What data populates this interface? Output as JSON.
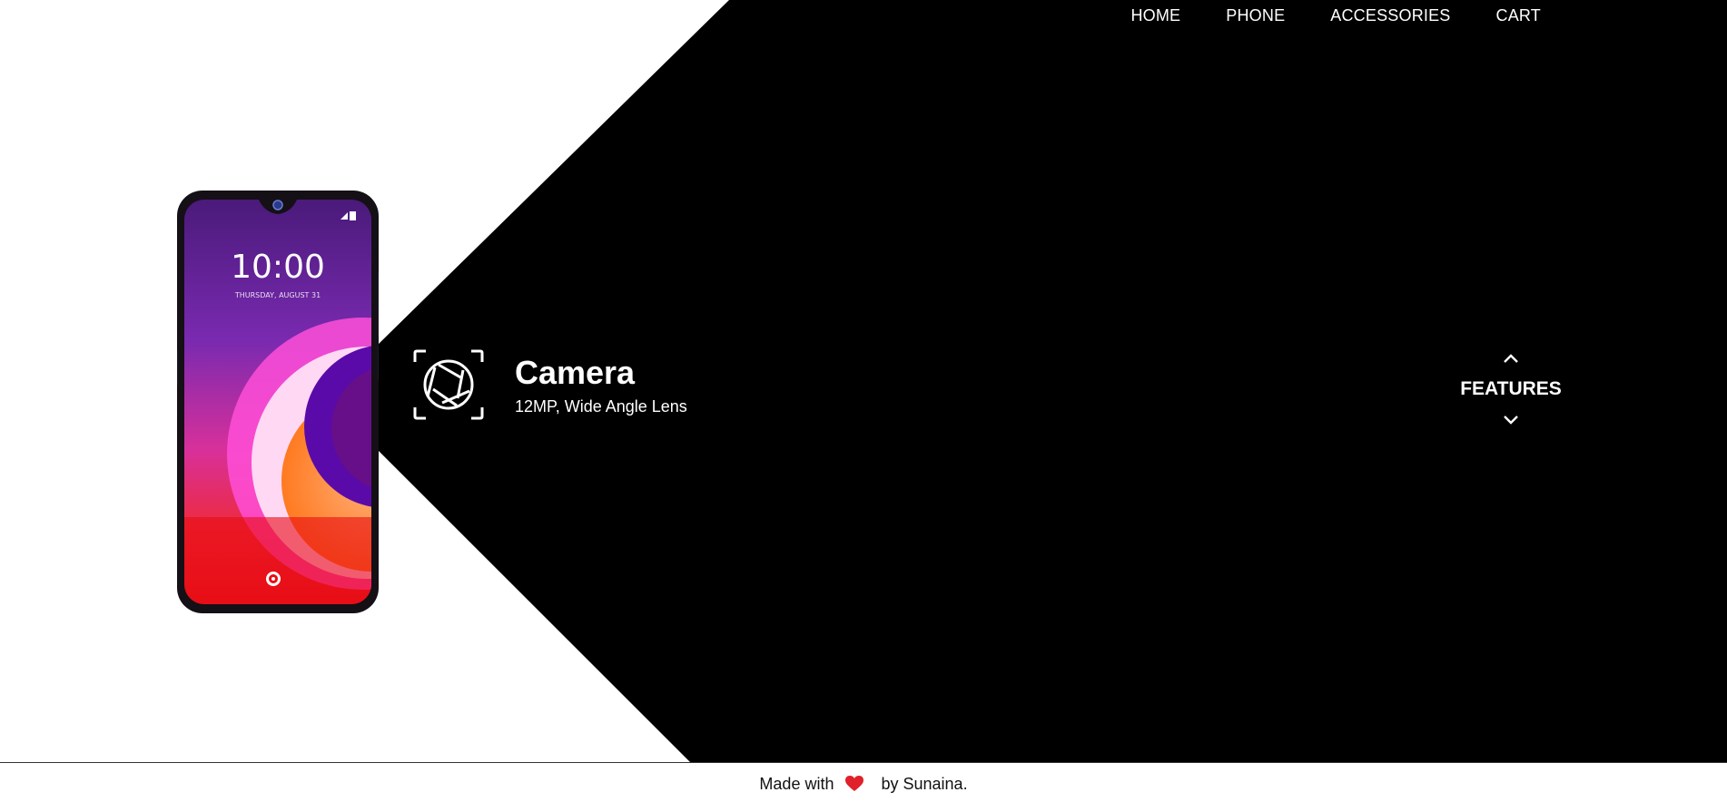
{
  "nav": {
    "items": [
      {
        "label": "HOME"
      },
      {
        "label": "PHONE"
      },
      {
        "label": "ACCESSORIES"
      },
      {
        "label": "CART"
      }
    ]
  },
  "phone_screen": {
    "time": "10:00",
    "date": "THURSDAY, AUGUST 31"
  },
  "feature": {
    "title": "Camera",
    "description": "12MP, Wide Angle Lens",
    "icon": "camera-aperture-icon"
  },
  "features_nav": {
    "label": "FEATURES",
    "up_icon": "chevron-up-icon",
    "down_icon": "chevron-down-icon"
  },
  "footer": {
    "prefix": "Made with",
    "heart_icon": "heart-icon",
    "suffix": "by Sunaina."
  },
  "colors": {
    "background": "#ffffff",
    "panel": "#000000",
    "heart": "#e0202a"
  }
}
